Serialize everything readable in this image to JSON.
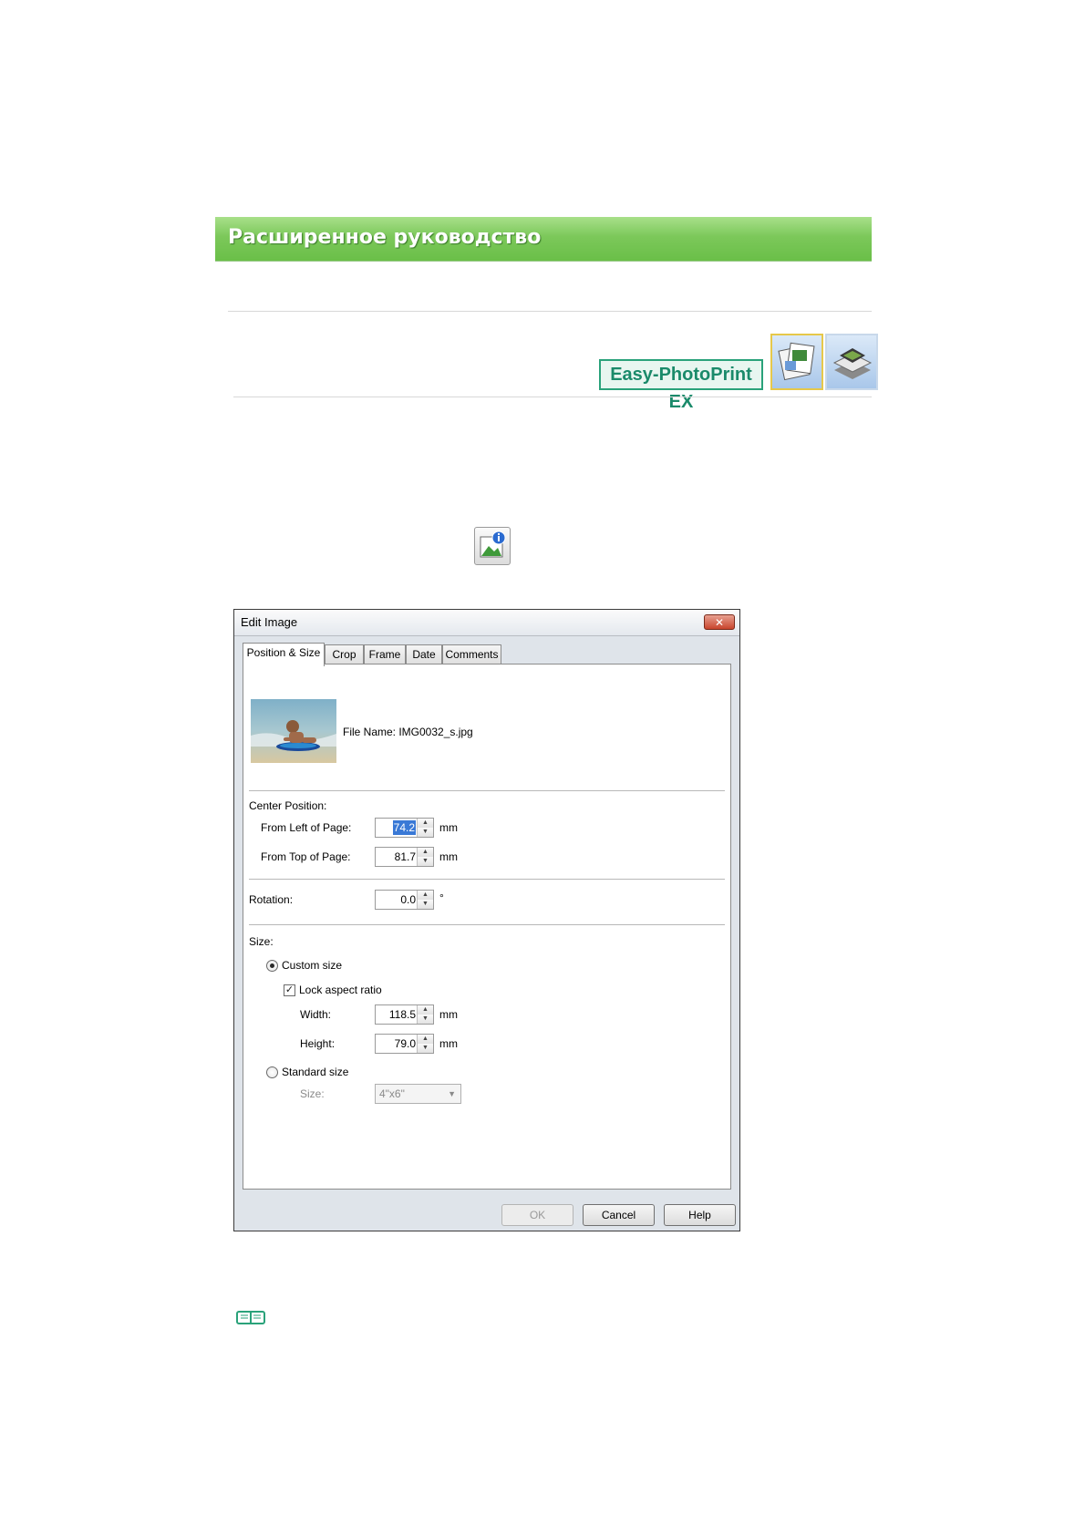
{
  "header": {
    "title": "Расширенное руководство"
  },
  "product": {
    "logo_text": "Easy-PhotoPrint EX"
  },
  "icons": {
    "app_icon_1": "photo-album-icon",
    "app_icon_2": "photo-print-stack-icon",
    "toolbar_icon": "image-info-icon",
    "note_icon": "note-book-icon"
  },
  "dialog": {
    "title": "Edit Image",
    "close_label": "✕",
    "tabs": [
      {
        "label": "Position & Size",
        "active": true
      },
      {
        "label": "Crop"
      },
      {
        "label": "Frame"
      },
      {
        "label": "Date"
      },
      {
        "label": "Comments"
      }
    ],
    "file_name": "File Name: IMG0032_s.jpg",
    "center_position": {
      "heading": "Center Position:",
      "from_left_label": "From Left of Page:",
      "from_left_value": "74.2",
      "from_top_label": "From Top of Page:",
      "from_top_value": "81.7",
      "unit": "mm"
    },
    "rotation": {
      "label": "Rotation:",
      "value": "0.0",
      "unit": "°"
    },
    "size": {
      "heading": "Size:",
      "custom_size_label": "Custom size",
      "custom_size_checked": true,
      "lock_aspect_label": "Lock aspect ratio",
      "lock_aspect_checked": true,
      "width_label": "Width:",
      "width_value": "118.5",
      "height_label": "Height:",
      "height_value": "79.0",
      "unit": "mm",
      "standard_size_label": "Standard size",
      "standard_size_checked": false,
      "standard_size_field_label": "Size:",
      "standard_size_value": "4\"x6\""
    },
    "buttons": {
      "ok": "OK",
      "cancel": "Cancel",
      "help": "Help"
    }
  },
  "colors": {
    "banner_green": "#7cc85a",
    "logo_teal": "#2aa27a",
    "selection_blue": "#3a79d6"
  }
}
